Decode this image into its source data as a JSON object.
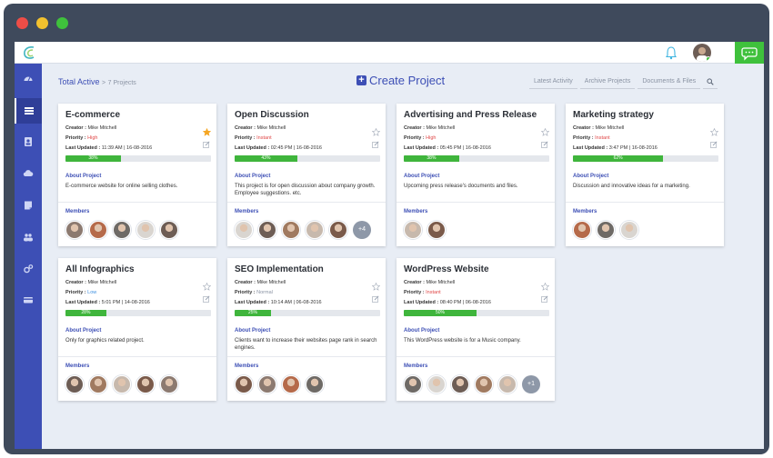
{
  "breadcrumb": {
    "section": "Total Active",
    "separator": ">",
    "count": "7 Projects"
  },
  "header": {
    "create_label": "Create Project"
  },
  "tabs": [
    "Latest Activity",
    "Archive Projects",
    "Documents & Files"
  ],
  "labels": {
    "creator": "Creator :",
    "priority": "Priority :",
    "updated": "Last Updated :",
    "about": "About Project",
    "members": "Members"
  },
  "colors": {
    "accent": "#3d4fb5",
    "progress": "#3fb53c",
    "star": "#f5a623"
  },
  "projects": [
    {
      "title": "E-commerce",
      "creator": "Mike Mitchell",
      "priority": "High",
      "updated": "11:39 AM | 16-08-2016",
      "progress": "38%",
      "progress_value": 38,
      "starred": true,
      "about": "E-commerce website for online selling clothes.",
      "extra_members": ""
    },
    {
      "title": "Open Discussion",
      "creator": "Mike Mitchell",
      "priority": "Instant",
      "updated": "02:45 PM | 16-08-2016",
      "progress": "43%",
      "progress_value": 43,
      "starred": false,
      "about": "This project is for open discussion about company growth. Employee suggestions. etc.",
      "extra_members": "+4"
    },
    {
      "title": "Advertising and Press Release",
      "creator": "Mike Mitchell",
      "priority": "High",
      "updated": "05:45 PM | 16-08-2016",
      "progress": "38%",
      "progress_value": 38,
      "starred": false,
      "about": "Upcoming press release's documents and files.",
      "extra_members": ""
    },
    {
      "title": "Marketing strategy",
      "creator": "Mike Mitchell",
      "priority": "Instant",
      "updated": "3:47 PM | 16-08-2016",
      "progress": "62%",
      "progress_value": 62,
      "starred": false,
      "about": "Discussion and innovative ideas for a marketing.",
      "extra_members": ""
    },
    {
      "title": "All Infographics",
      "creator": "Mike Mitchell",
      "priority": "Low",
      "updated": "5:01 PM | 14-08-2016",
      "progress": "28%",
      "progress_value": 28,
      "starred": false,
      "about": "Only for graphics related project.",
      "extra_members": ""
    },
    {
      "title": "SEO Implementation",
      "creator": "Mike Mitchell",
      "priority": "Normal",
      "updated": "10:14 AM | 06-08-2016",
      "progress": "25%",
      "progress_value": 25,
      "starred": false,
      "about": "Clients want to increase their websites page rank in search engines.",
      "extra_members": ""
    },
    {
      "title": "WordPress Website",
      "creator": "Mike Mitchell",
      "priority": "Instant",
      "updated": "08:40 PM | 06-08-2016",
      "progress": "50%",
      "progress_value": 50,
      "starred": false,
      "about": "This WordPress website is for a Music company.",
      "extra_members": "+1"
    }
  ]
}
